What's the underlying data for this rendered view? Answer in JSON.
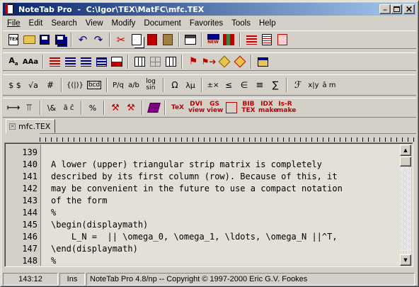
{
  "window": {
    "title": "NoteTab Pro  -  C:\\Igor\\TEX\\MatFC\\mfc.TEX",
    "minimize": "_",
    "maximize": "□",
    "close": "×"
  },
  "menu": [
    "File",
    "Edit",
    "Search",
    "View",
    "Modify",
    "Document",
    "Favorites",
    "Tools",
    "Help"
  ],
  "toolbar1": [
    "TEX",
    "open",
    "save",
    "save-all",
    "undo",
    "redo",
    "cut",
    "copy",
    "paste",
    "paste-special",
    "clipboard",
    "new",
    "bookmark",
    "outline",
    "print",
    "mail"
  ],
  "toolbar2": {
    "font_small": "A",
    "font_large": "AAa"
  },
  "toolbar3": {
    "dollar": "$ $",
    "sqrt": "√a",
    "hash": "#",
    "braces": "{(|)}",
    "bcd": "bcd",
    "frac1": "P/q",
    "frac2": "a/b",
    "log": "log sin",
    "omega": "Ω",
    "lambda": "λμ",
    "pm": "±×",
    "ineq": "≤",
    "ein": "∈",
    "equiv": "≡",
    "sum": "∑",
    "scriptF": "ℱ",
    "xy": "x|y",
    "arrows": "ā m"
  },
  "toolbar4": {
    "amp": "\\&",
    "accent": "ã ĉ",
    "pct": "%",
    "tex": "TeX",
    "dvi": "DVI view",
    "gs": "GS view",
    "bib": "BIB TEX",
    "idx": "IDX make",
    "isr": "Is-R make"
  },
  "tab": {
    "label": "mfc.TEX"
  },
  "editor": {
    "lines": [
      {
        "n": "139",
        "t": ""
      },
      {
        "n": "140",
        "t": "A lower (upper) triangular strip matrix is completely"
      },
      {
        "n": "141",
        "t": "described by its first column (row). Because of this, it"
      },
      {
        "n": "142",
        "t": "may be convenient in the future to use a compact notation"
      },
      {
        "n": "143",
        "t": "of the form"
      },
      {
        "n": "144",
        "t": "%"
      },
      {
        "n": "145",
        "t": "\\begin(displaymath)"
      },
      {
        "n": "146",
        "t": "    L_N =  || \\omega_0, \\omega_1, \\ldots, \\omega_N ||^T,"
      },
      {
        "n": "147",
        "t": "\\end(displaymath)"
      },
      {
        "n": "148",
        "t": "%"
      }
    ]
  },
  "status": {
    "pos": "143:12",
    "mode": "Ins",
    "info": "NoteTab Pro 4.8/np -- Copyright © 1997-2000 Eric G.V. Fookes"
  }
}
